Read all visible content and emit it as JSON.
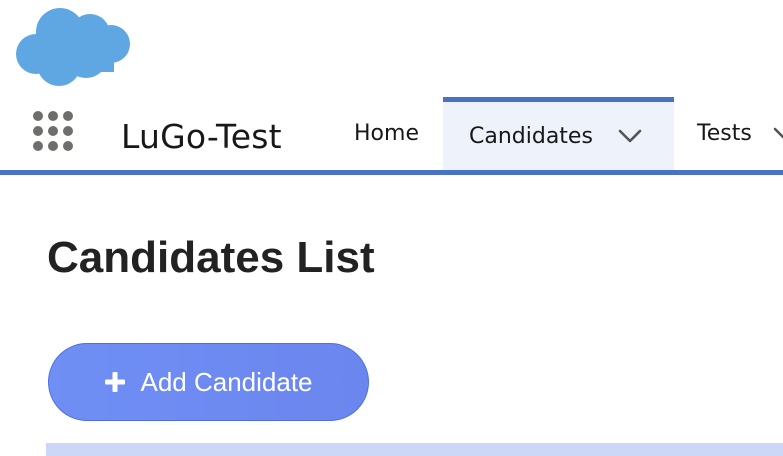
{
  "header": {
    "logo_icon": "cloud-icon",
    "logo_color": "#5ea7e3"
  },
  "nav": {
    "app_launcher_icon": "app-launcher-grid-icon",
    "app_name": "LuGo-Test",
    "tabs": [
      {
        "label": "Home",
        "active": false,
        "has_dropdown": false
      },
      {
        "label": "Candidates",
        "active": true,
        "has_dropdown": true
      },
      {
        "label": "Tests",
        "active": false,
        "has_dropdown": true
      }
    ],
    "accent_color": "#4a72c4",
    "active_tab_bg": "#eef2fa"
  },
  "main": {
    "title": "Candidates List",
    "add_button": {
      "label": "Add Candidate",
      "icon": "plus-icon",
      "color": "#6f8ff5"
    },
    "table_header_color": "#ccd7f7"
  }
}
